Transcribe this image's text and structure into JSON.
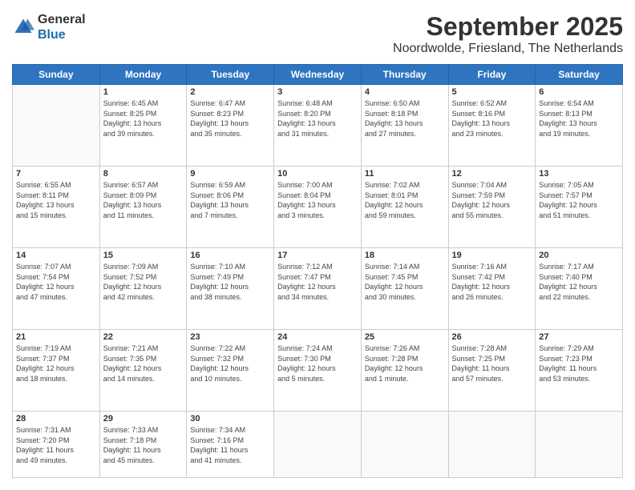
{
  "logo": {
    "general": "General",
    "blue": "Blue"
  },
  "title": "September 2025",
  "subtitle": "Noordwolde, Friesland, The Netherlands",
  "days_of_week": [
    "Sunday",
    "Monday",
    "Tuesday",
    "Wednesday",
    "Thursday",
    "Friday",
    "Saturday"
  ],
  "weeks": [
    [
      {
        "day": "",
        "info": ""
      },
      {
        "day": "1",
        "info": "Sunrise: 6:45 AM\nSunset: 8:25 PM\nDaylight: 13 hours\nand 39 minutes."
      },
      {
        "day": "2",
        "info": "Sunrise: 6:47 AM\nSunset: 8:23 PM\nDaylight: 13 hours\nand 35 minutes."
      },
      {
        "day": "3",
        "info": "Sunrise: 6:48 AM\nSunset: 8:20 PM\nDaylight: 13 hours\nand 31 minutes."
      },
      {
        "day": "4",
        "info": "Sunrise: 6:50 AM\nSunset: 8:18 PM\nDaylight: 13 hours\nand 27 minutes."
      },
      {
        "day": "5",
        "info": "Sunrise: 6:52 AM\nSunset: 8:16 PM\nDaylight: 13 hours\nand 23 minutes."
      },
      {
        "day": "6",
        "info": "Sunrise: 6:54 AM\nSunset: 8:13 PM\nDaylight: 13 hours\nand 19 minutes."
      }
    ],
    [
      {
        "day": "7",
        "info": "Sunrise: 6:55 AM\nSunset: 8:11 PM\nDaylight: 13 hours\nand 15 minutes."
      },
      {
        "day": "8",
        "info": "Sunrise: 6:57 AM\nSunset: 8:09 PM\nDaylight: 13 hours\nand 11 minutes."
      },
      {
        "day": "9",
        "info": "Sunrise: 6:59 AM\nSunset: 8:06 PM\nDaylight: 13 hours\nand 7 minutes."
      },
      {
        "day": "10",
        "info": "Sunrise: 7:00 AM\nSunset: 8:04 PM\nDaylight: 13 hours\nand 3 minutes."
      },
      {
        "day": "11",
        "info": "Sunrise: 7:02 AM\nSunset: 8:01 PM\nDaylight: 12 hours\nand 59 minutes."
      },
      {
        "day": "12",
        "info": "Sunrise: 7:04 AM\nSunset: 7:59 PM\nDaylight: 12 hours\nand 55 minutes."
      },
      {
        "day": "13",
        "info": "Sunrise: 7:05 AM\nSunset: 7:57 PM\nDaylight: 12 hours\nand 51 minutes."
      }
    ],
    [
      {
        "day": "14",
        "info": "Sunrise: 7:07 AM\nSunset: 7:54 PM\nDaylight: 12 hours\nand 47 minutes."
      },
      {
        "day": "15",
        "info": "Sunrise: 7:09 AM\nSunset: 7:52 PM\nDaylight: 12 hours\nand 42 minutes."
      },
      {
        "day": "16",
        "info": "Sunrise: 7:10 AM\nSunset: 7:49 PM\nDaylight: 12 hours\nand 38 minutes."
      },
      {
        "day": "17",
        "info": "Sunrise: 7:12 AM\nSunset: 7:47 PM\nDaylight: 12 hours\nand 34 minutes."
      },
      {
        "day": "18",
        "info": "Sunrise: 7:14 AM\nSunset: 7:45 PM\nDaylight: 12 hours\nand 30 minutes."
      },
      {
        "day": "19",
        "info": "Sunrise: 7:16 AM\nSunset: 7:42 PM\nDaylight: 12 hours\nand 26 minutes."
      },
      {
        "day": "20",
        "info": "Sunrise: 7:17 AM\nSunset: 7:40 PM\nDaylight: 12 hours\nand 22 minutes."
      }
    ],
    [
      {
        "day": "21",
        "info": "Sunrise: 7:19 AM\nSunset: 7:37 PM\nDaylight: 12 hours\nand 18 minutes."
      },
      {
        "day": "22",
        "info": "Sunrise: 7:21 AM\nSunset: 7:35 PM\nDaylight: 12 hours\nand 14 minutes."
      },
      {
        "day": "23",
        "info": "Sunrise: 7:22 AM\nSunset: 7:32 PM\nDaylight: 12 hours\nand 10 minutes."
      },
      {
        "day": "24",
        "info": "Sunrise: 7:24 AM\nSunset: 7:30 PM\nDaylight: 12 hours\nand 5 minutes."
      },
      {
        "day": "25",
        "info": "Sunrise: 7:26 AM\nSunset: 7:28 PM\nDaylight: 12 hours\nand 1 minute."
      },
      {
        "day": "26",
        "info": "Sunrise: 7:28 AM\nSunset: 7:25 PM\nDaylight: 11 hours\nand 57 minutes."
      },
      {
        "day": "27",
        "info": "Sunrise: 7:29 AM\nSunset: 7:23 PM\nDaylight: 11 hours\nand 53 minutes."
      }
    ],
    [
      {
        "day": "28",
        "info": "Sunrise: 7:31 AM\nSunset: 7:20 PM\nDaylight: 11 hours\nand 49 minutes."
      },
      {
        "day": "29",
        "info": "Sunrise: 7:33 AM\nSunset: 7:18 PM\nDaylight: 11 hours\nand 45 minutes."
      },
      {
        "day": "30",
        "info": "Sunrise: 7:34 AM\nSunset: 7:16 PM\nDaylight: 11 hours\nand 41 minutes."
      },
      {
        "day": "",
        "info": ""
      },
      {
        "day": "",
        "info": ""
      },
      {
        "day": "",
        "info": ""
      },
      {
        "day": "",
        "info": ""
      }
    ]
  ]
}
